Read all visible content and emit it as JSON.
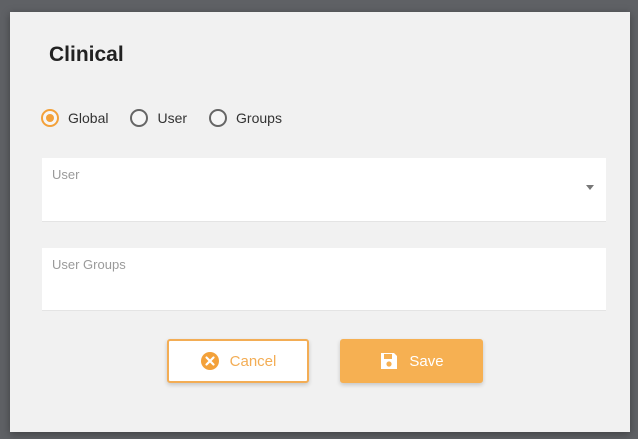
{
  "dialog": {
    "title": "Clinical"
  },
  "scope_options": [
    {
      "label": "Global",
      "checked": true
    },
    {
      "label": "User",
      "checked": false
    },
    {
      "label": "Groups",
      "checked": false
    }
  ],
  "fields": {
    "user": {
      "label": "User",
      "value": ""
    },
    "user_groups": {
      "label": "User Groups",
      "value": ""
    }
  },
  "buttons": {
    "cancel_label": "Cancel",
    "save_label": "Save"
  },
  "colors": {
    "accent": "#f3a13a",
    "save_bg": "#f6b052"
  },
  "icons": {
    "cancel": "close-circle-icon",
    "save": "floppy-disk-icon",
    "dropdown": "caret-down-icon"
  }
}
